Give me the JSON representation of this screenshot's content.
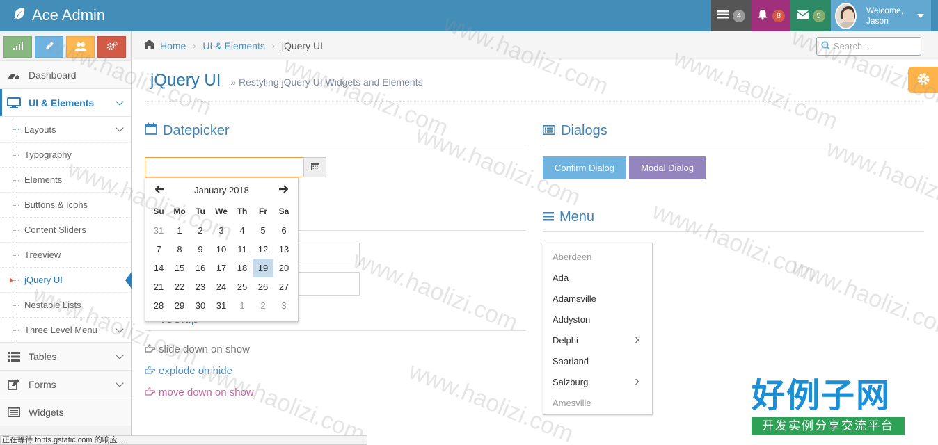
{
  "brand": {
    "name": "Ace Admin"
  },
  "navbar": {
    "tasks_count": "4",
    "notifications_count": "8",
    "messages_count": "5",
    "welcome": "Welcome,",
    "user_name": "Jason"
  },
  "sidebar": {
    "items": [
      {
        "label": "Dashboard"
      },
      {
        "label": "UI & Elements"
      },
      {
        "label": "Tables"
      },
      {
        "label": "Forms"
      },
      {
        "label": "Widgets"
      }
    ],
    "submenu": [
      {
        "label": "Layouts"
      },
      {
        "label": "Typography"
      },
      {
        "label": "Elements"
      },
      {
        "label": "Buttons & Icons"
      },
      {
        "label": "Content Sliders"
      },
      {
        "label": "Treeview"
      },
      {
        "label": "jQuery UI"
      },
      {
        "label": "Nestable Lists"
      },
      {
        "label": "Three Level Menu"
      }
    ]
  },
  "breadcrumb": {
    "home": "Home",
    "parent": "UI & Elements",
    "current": "jQuery UI"
  },
  "search": {
    "placeholder": "Search ..."
  },
  "page": {
    "title": "jQuery UI",
    "subtitle": "» Restyling jQuery UI Widgets and Elements"
  },
  "datepicker": {
    "title": "Datepicker",
    "month": "January 2018",
    "dow": [
      "Su",
      "Mo",
      "Tu",
      "We",
      "Th",
      "Fr",
      "Sa"
    ],
    "weeks": [
      [
        "31",
        "1",
        "2",
        "3",
        "4",
        "5",
        "6"
      ],
      [
        "7",
        "8",
        "9",
        "10",
        "11",
        "12",
        "13"
      ],
      [
        "14",
        "15",
        "16",
        "17",
        "18",
        "19",
        "20"
      ],
      [
        "21",
        "22",
        "23",
        "24",
        "25",
        "26",
        "27"
      ],
      [
        "28",
        "29",
        "30",
        "31",
        "1",
        "2",
        "3"
      ]
    ],
    "today": "19"
  },
  "tooltip": {
    "title": "Tooltip",
    "links": [
      {
        "label": "slide down on show",
        "color": "#777777"
      },
      {
        "label": "explode on hide",
        "color": "#4a90c4"
      },
      {
        "label": "move down on show",
        "color": "#c6699f"
      }
    ]
  },
  "dialogs": {
    "title": "Dialogs",
    "confirm": "Confirm Dialog",
    "modal": "Modal Dialog"
  },
  "menu": {
    "title": "Menu",
    "items": [
      {
        "label": "Aberdeen"
      },
      {
        "label": "Ada"
      },
      {
        "label": "Adamsville"
      },
      {
        "label": "Addyston"
      },
      {
        "label": "Delphi"
      },
      {
        "label": "Saarland"
      },
      {
        "label": "Salzburg"
      },
      {
        "label": "Amesville"
      }
    ]
  },
  "status_bar": "正在等待 fonts.gstatic.com 的响应...",
  "watermark": {
    "text": "www.haolizi.com",
    "logo_big": "好例子网",
    "logo_small": "开发实例分享交流平台"
  },
  "colors": {
    "navbar": "#438eb9",
    "accent": "#2b7dbc",
    "info": "#6fb3e0",
    "purple": "#9585bf"
  }
}
